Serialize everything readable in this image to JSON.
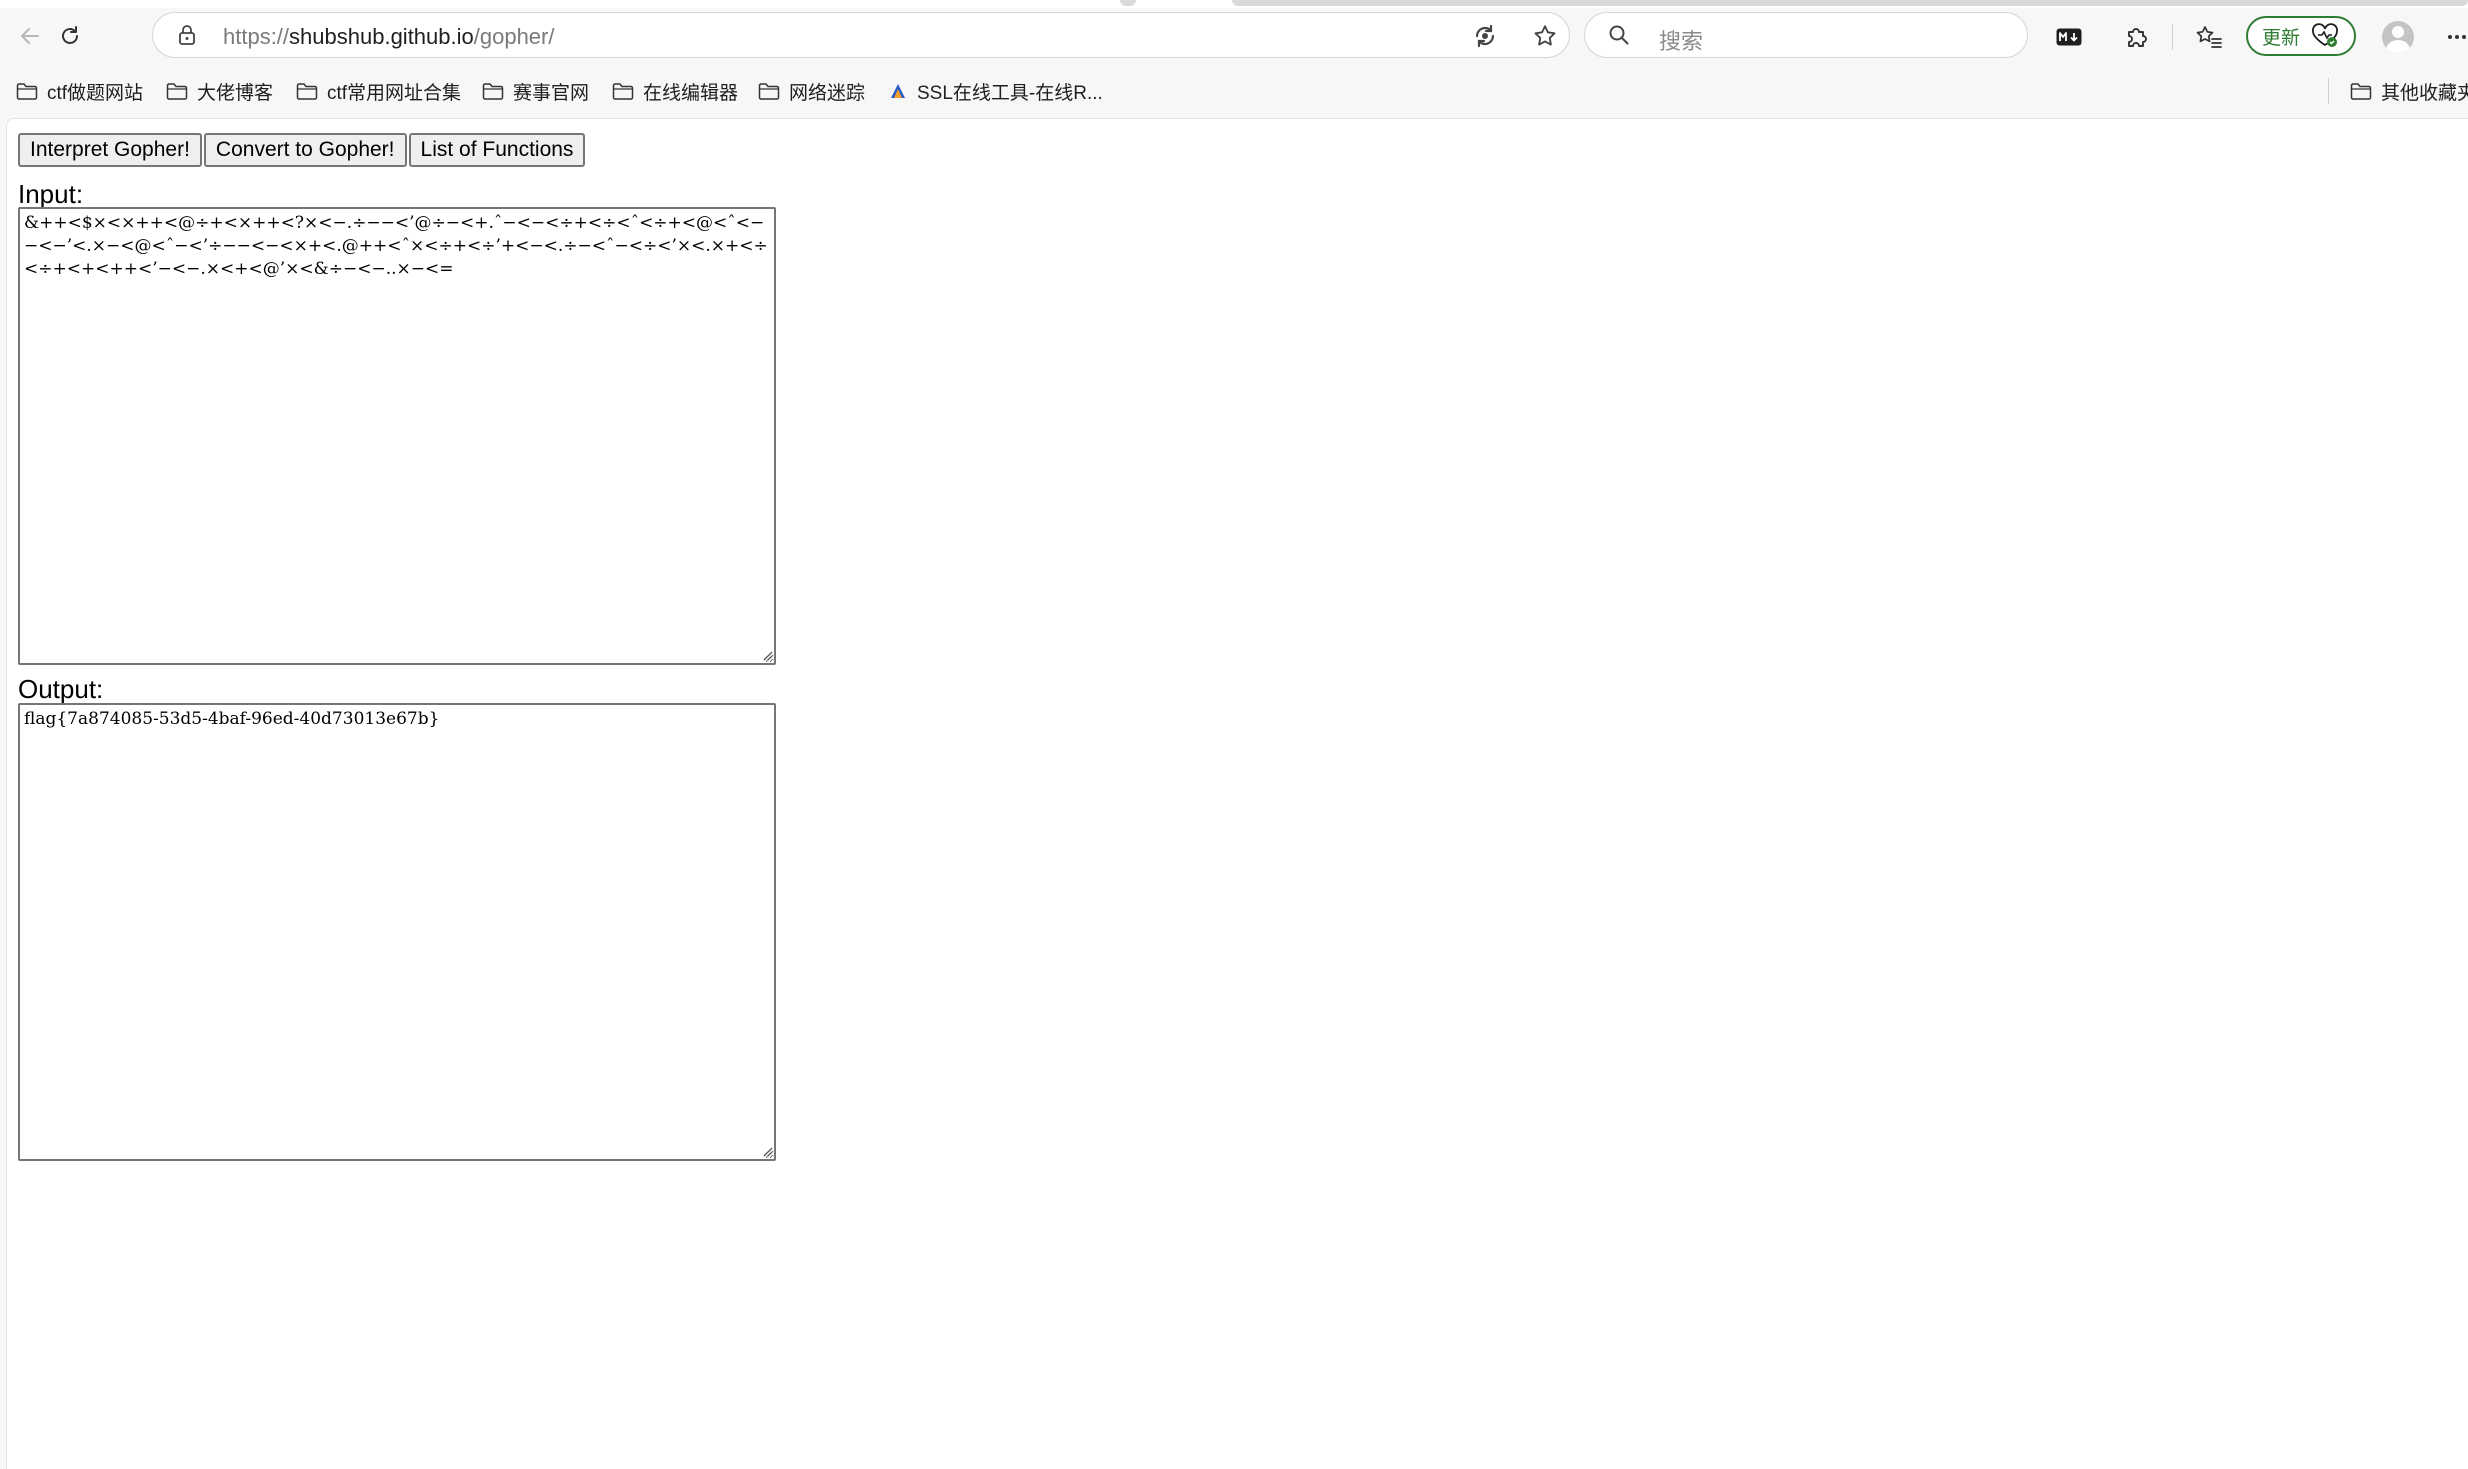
{
  "browser": {
    "url_prefix": "https://",
    "url_host": "shubshub.github.io",
    "url_path": "/gopher/",
    "search_placeholder": "搜索",
    "update_label": "更新",
    "colors": {
      "update_green": "#2e7d32",
      "chrome_bg": "#f7f7f7"
    },
    "icons": [
      "back-arrow-icon",
      "refresh-icon",
      "lock-icon",
      "read-aloud-icon",
      "favorite-star-icon",
      "search-icon",
      "markdown-icon",
      "extensions-icon",
      "favorites-icon",
      "update-status-icon",
      "profile-avatar",
      "more-menu-icon"
    ]
  },
  "bookmarks": {
    "items": [
      {
        "label": "ctf做题网站",
        "icon": "folder-icon"
      },
      {
        "label": "大佬博客",
        "icon": "folder-icon"
      },
      {
        "label": "ctf常用网址合集",
        "icon": "folder-icon"
      },
      {
        "label": "赛事官网",
        "icon": "folder-icon"
      },
      {
        "label": "在线编辑器",
        "icon": "folder-icon"
      },
      {
        "label": "网络迷踪",
        "icon": "folder-icon"
      },
      {
        "label": "SSL在线工具-在线R...",
        "icon": "ssl-site-icon"
      }
    ],
    "other": {
      "label": "其他收藏夹",
      "icon": "folder-icon"
    }
  },
  "page": {
    "buttons": {
      "interpret": "Interpret Gopher!",
      "convert": "Convert to Gopher!",
      "functions": "List of Functions"
    },
    "input_label": "Input:",
    "input_value": "&++<$×<×++<@÷+<×++<?×<−.÷−−<’@÷−<+.ˆ−<−<÷+<÷<ˆ<÷+<@<ˆ<−−<−’<.×−<@<ˆ−<’÷−−<−<×+<.@++<ˆ×<÷+<÷’+<−<.÷−<ˆ−<÷<’×<.×+<÷<÷+<+<++<’−<−.×<+<@’×<&÷−<−..×−<=",
    "output_label": "Output:",
    "output_value": "flag{7a874085-53d5-4baf-96ed-40d73013e67b}"
  }
}
